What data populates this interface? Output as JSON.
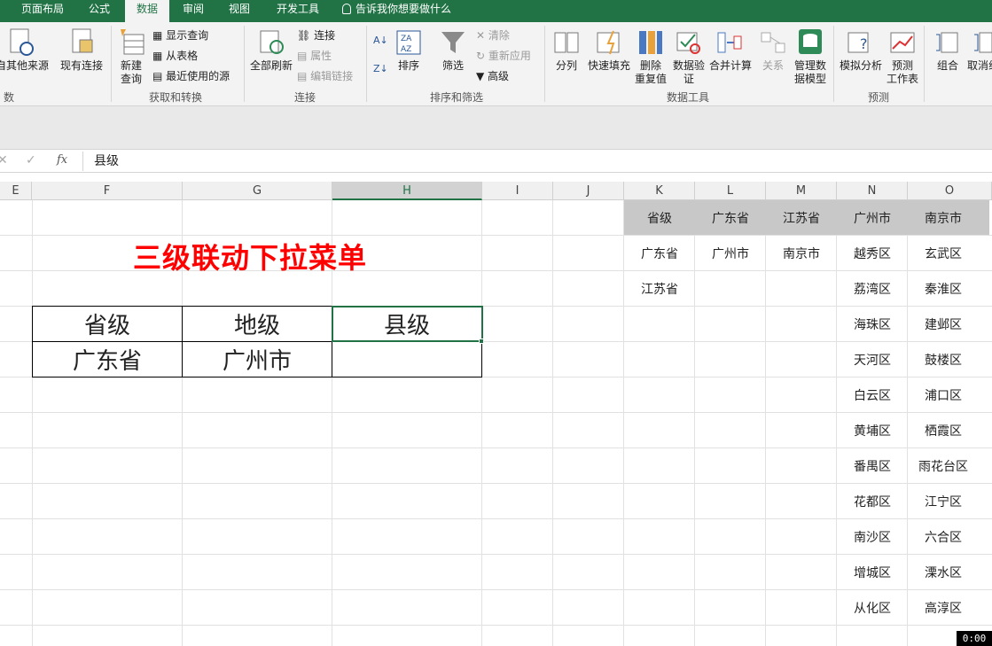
{
  "ribbon_tabs": [
    {
      "label": "页面布局",
      "active": false
    },
    {
      "label": "公式",
      "active": false
    },
    {
      "label": "数据",
      "active": true
    },
    {
      "label": "审阅",
      "active": false
    },
    {
      "label": "视图",
      "active": false
    },
    {
      "label": "开发工具",
      "active": false
    }
  ],
  "tell_me": "告诉我你想要做什么",
  "groups": {
    "get_data": {
      "label": "数据",
      "other_sources": "自其他来源",
      "existing": "现有连接"
    },
    "get_transform": {
      "label": "获取和转换",
      "new_query": "新建\n查询",
      "show_queries": "显示查询",
      "from_table": "从表格",
      "recent_sources": "最近使用的源"
    },
    "connections": {
      "label": "连接",
      "refresh_all": "全部刷新",
      "connections": "连接",
      "properties": "属性",
      "edit_links": "编辑链接"
    },
    "sort_filter": {
      "label": "排序和筛选",
      "sort": "排序",
      "filter": "筛选",
      "clear": "清除",
      "reapply": "重新应用",
      "advanced": "高级"
    },
    "data_tools": {
      "label": "数据工具",
      "text_to_columns": "分列",
      "flash_fill": "快速填充",
      "remove_dup": "删除\n重复值",
      "validation": "数据验\n证",
      "consolidate": "合并计算",
      "relationships": "关系",
      "data_model": "管理数\n据模型"
    },
    "forecast": {
      "label": "预测",
      "what_if": "模拟分析",
      "forecast_sheet": "预测\n工作表"
    },
    "outline": {
      "group": "组合",
      "ungroup": "取消组"
    }
  },
  "formula_bar": {
    "cancel": "✕",
    "enter": "✓",
    "fx": "fx",
    "value": "县级"
  },
  "columns": [
    "E",
    "F",
    "G",
    "H",
    "I",
    "J",
    "K",
    "L",
    "M",
    "N",
    "O"
  ],
  "title": "三级联动下拉菜单",
  "form": {
    "headers": [
      "省级",
      "地级",
      "县级"
    ],
    "values": [
      "广东省",
      "广州市",
      ""
    ]
  },
  "lists": {
    "K": {
      "header": "省级",
      "items": [
        "广东省",
        "江苏省"
      ]
    },
    "L": {
      "header": "广东省",
      "items": [
        "广州市"
      ]
    },
    "M": {
      "header": "江苏省",
      "items": [
        "南京市"
      ]
    },
    "N": {
      "header": "广州市",
      "items": [
        "越秀区",
        "荔湾区",
        "海珠区",
        "天河区",
        "白云区",
        "黄埔区",
        "番禺区",
        "花都区",
        "南沙区",
        "增城区",
        "从化区"
      ]
    },
    "O": {
      "header": "南京市",
      "items": [
        "玄武区",
        "秦淮区",
        "建邺区",
        "鼓楼区",
        "浦口区",
        "栖霞区",
        "雨花台区",
        "江宁区",
        "六合区",
        "溧水区",
        "高淳区"
      ]
    }
  },
  "timer": "0:00",
  "colors": {
    "accent": "#217346",
    "title": "#ff0000",
    "header_band": "#c8c8c8"
  }
}
